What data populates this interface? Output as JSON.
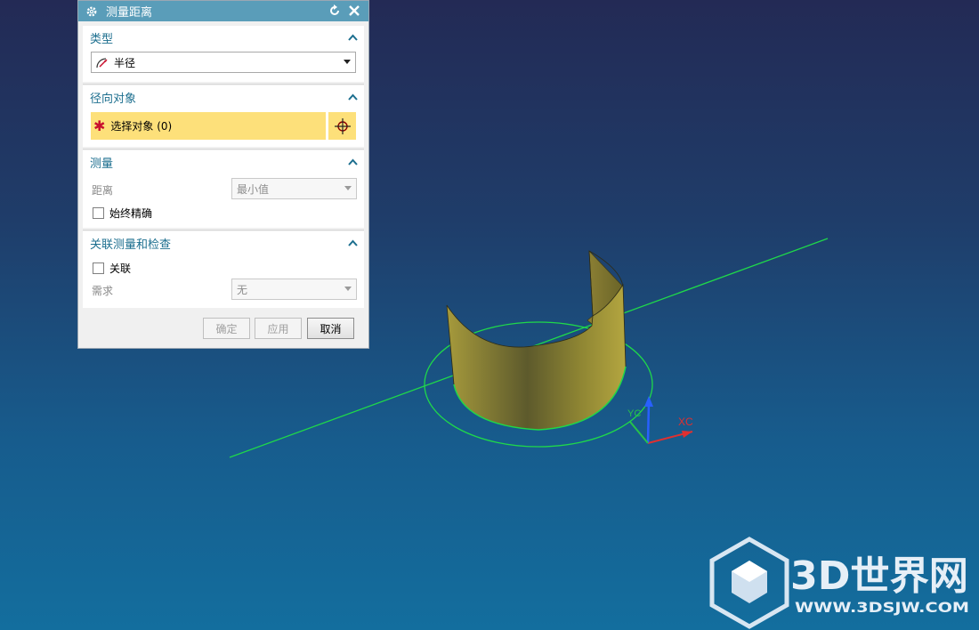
{
  "dialog": {
    "title": "测量距离",
    "sections": {
      "type": {
        "label": "类型",
        "value": "半径"
      },
      "radial": {
        "label": "径向对象",
        "select_label": "选择对象 (0)"
      },
      "measure": {
        "label": "测量",
        "distance_label": "距离",
        "distance_value": "最小值",
        "always_precise": "始终精确"
      },
      "assoc": {
        "label": "关联测量和检查",
        "associative": "关联",
        "requirement_label": "需求",
        "requirement_value": "无"
      }
    },
    "buttons": {
      "ok": "确定",
      "apply": "应用",
      "cancel": "取消"
    }
  },
  "viewport": {
    "triad": {
      "x_label": "XC",
      "y_label": "YC"
    },
    "colors": {
      "surface": "#8f8734",
      "line": "#1fd84a",
      "x_axis": "#e03030",
      "z_axis": "#2860ff",
      "y_axis": "#27c24a"
    }
  },
  "watermark": {
    "brand": "3D世界网",
    "url": "WWW.3DSJW.COM"
  }
}
